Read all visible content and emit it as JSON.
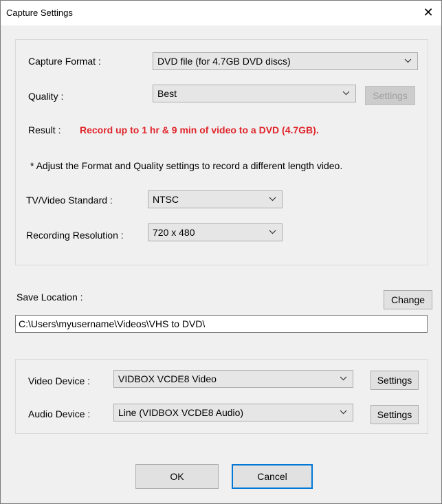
{
  "window": {
    "title": "Capture Settings",
    "close_glyph": "✕"
  },
  "capture": {
    "format_label": "Capture Format :",
    "format_value": "DVD file (for 4.7GB DVD discs)",
    "quality_label": "Quality :",
    "quality_value": "Best",
    "quality_settings_label": "Settings",
    "result_label": "Result :",
    "result_text": "Record up to 1 hr & 9 min of  video to a DVD (4.7GB).",
    "note": "*  Adjust the Format and Quality settings to record a different length video.",
    "standard_label": "TV/Video Standard :",
    "standard_value": "NTSC",
    "resolution_label": "Recording Resolution :",
    "resolution_value": "720 x 480"
  },
  "save": {
    "label": "Save Location :",
    "change_label": "Change",
    "path": "C:\\Users\\myusername\\Videos\\VHS to DVD\\"
  },
  "devices": {
    "video_label": "Video Device :",
    "video_value": "VIDBOX VCDE8 Video",
    "video_settings_label": "Settings",
    "audio_label": "Audio Device :",
    "audio_value": "Line (VIDBOX VCDE8 Audio)",
    "audio_settings_label": "Settings"
  },
  "footer": {
    "ok_label": "OK",
    "cancel_label": "Cancel"
  },
  "colors": {
    "result_red": "#e0242a",
    "focus_blue": "#0078d7"
  },
  "icons": {
    "dropdown": "chevron-down-icon",
    "close": "close-icon"
  }
}
